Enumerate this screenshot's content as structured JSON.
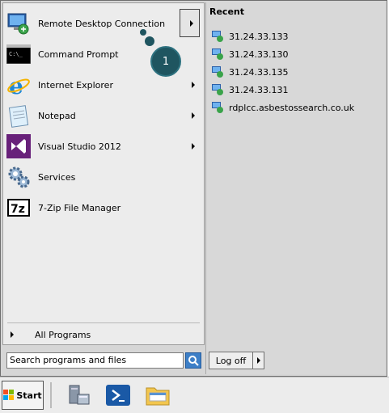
{
  "start_menu": {
    "programs": [
      {
        "label": "Remote Desktop Connection",
        "icon": "remote-desktop-icon",
        "has_submenu": true
      },
      {
        "label": "Command Prompt",
        "icon": "command-prompt-icon",
        "has_submenu": false
      },
      {
        "label": "Internet Explorer",
        "icon": "internet-explorer-icon",
        "has_submenu": true
      },
      {
        "label": "Notepad",
        "icon": "notepad-icon",
        "has_submenu": true
      },
      {
        "label": "Visual Studio 2012",
        "icon": "visual-studio-icon",
        "has_submenu": true
      },
      {
        "label": "Services",
        "icon": "services-icon",
        "has_submenu": false
      },
      {
        "label": "7-Zip File Manager",
        "icon": "7zip-icon",
        "has_submenu": false
      }
    ],
    "all_programs": "All Programs",
    "search_value": "Search programs and files",
    "log_off": "Log off"
  },
  "recent": {
    "title": "Recent",
    "items": [
      "31.24.33.133",
      "31.24.33.130",
      "31.24.33.135",
      "31.24.33.131",
      "rdplcc.asbestossearch.co.uk"
    ]
  },
  "callout": {
    "number": "1"
  },
  "taskbar": {
    "start_label": "Start"
  },
  "colors": {
    "callout": "#1f5560",
    "search_button": "#3d7fc7",
    "vs_purple": "#68217a",
    "ie_blue": "#1e88d6"
  }
}
